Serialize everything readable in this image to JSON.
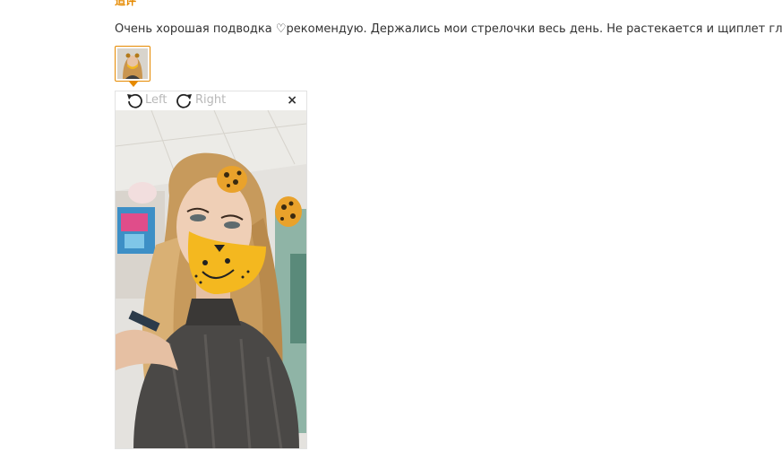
{
  "followup_label": "追评",
  "review_text": "Очень хорошая подводка ♡рекомендую. Держались мои стрелочки весь день. Не растекается и щиплет глаза☆",
  "viewer": {
    "rotate_left_label": "Left",
    "rotate_right_label": "Right",
    "close_label": "×"
  },
  "colors": {
    "accent": "#e68a00",
    "text": "#333333",
    "toolbar_text": "#b8b8b8"
  },
  "icons": [
    "rotate-left-icon",
    "rotate-right-icon",
    "close-icon",
    "thumbnail-photo",
    "pointer-arrow"
  ]
}
